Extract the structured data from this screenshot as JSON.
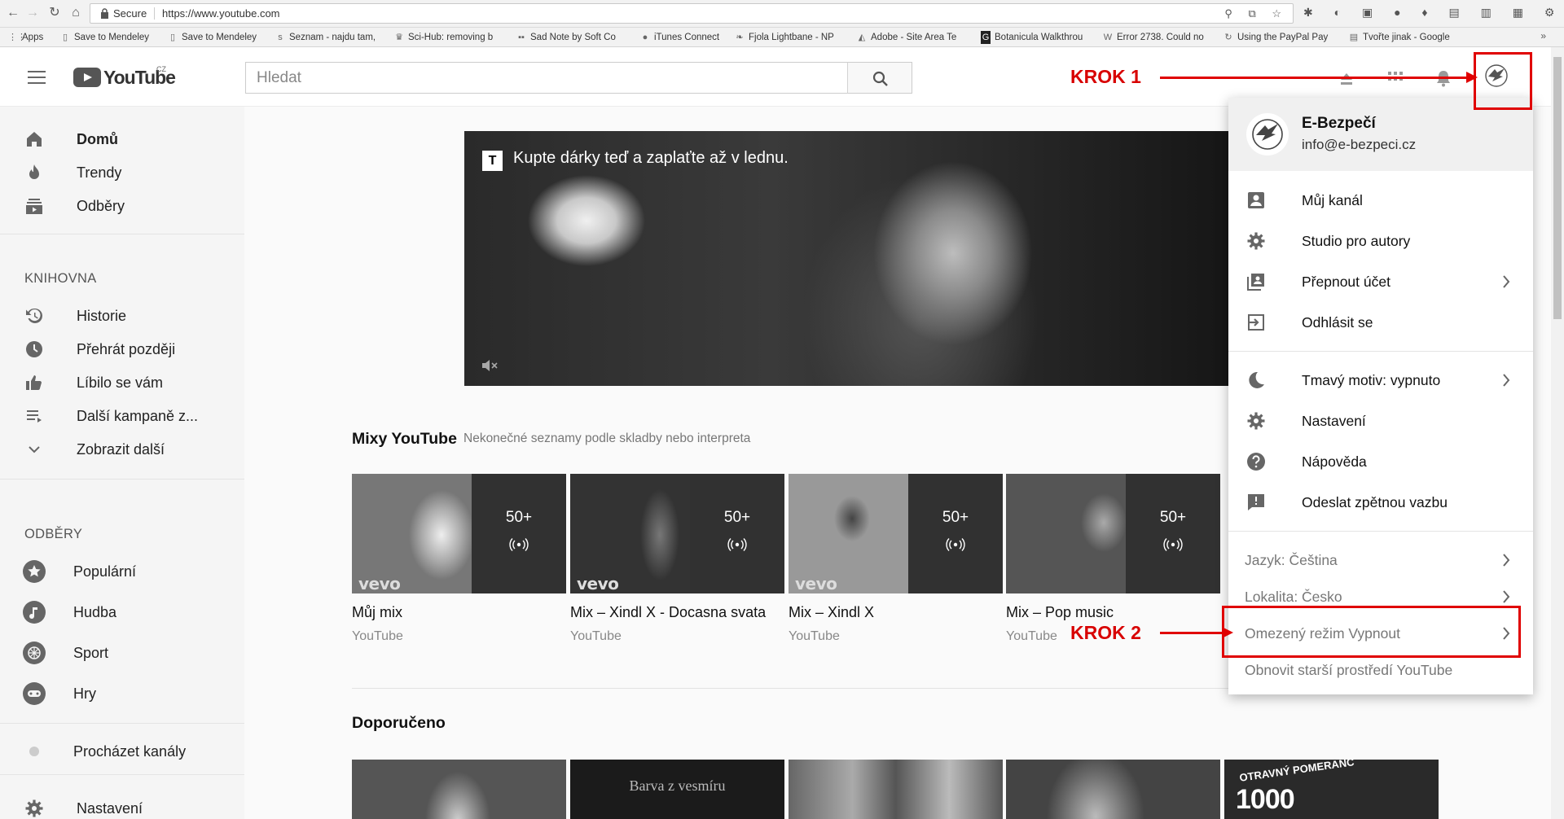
{
  "browser": {
    "secure_label": "Secure",
    "url": "https://www.youtube.com",
    "bookmarks": [
      {
        "icon": "apps-icon",
        "label": "Apps"
      },
      {
        "icon": "page-icon",
        "label": "Save to Mendeley"
      },
      {
        "icon": "page-icon",
        "label": "Save to Mendeley"
      },
      {
        "icon": "seznam-icon",
        "label": "Seznam - najdu tam,"
      },
      {
        "icon": "scihub-icon",
        "label": "Sci-Hub: removing b"
      },
      {
        "icon": "softcorp-icon",
        "label": "Sad Note by Soft Co"
      },
      {
        "icon": "apple-icon",
        "label": "iTunes Connect"
      },
      {
        "icon": "leaf-icon",
        "label": "Fjola Lightbane - NP"
      },
      {
        "icon": "adobe-icon",
        "label": "Adobe - Site Area Te"
      },
      {
        "icon": "g-icon",
        "label": "Botanicula Walkthrou"
      },
      {
        "icon": "wiki-icon",
        "label": "Error 2738. Could no"
      },
      {
        "icon": "refresh-icon",
        "label": "Using the PayPal Pay"
      },
      {
        "icon": "form-icon",
        "label": "Tvořte jinak - Google"
      }
    ],
    "more_bookmarks": "»"
  },
  "masthead": {
    "logo_text": "YouTube",
    "country_code": "CZ",
    "search_placeholder": "Hledat"
  },
  "sidebar": {
    "main": [
      {
        "icon": "home-icon",
        "label": "Domů",
        "active": true
      },
      {
        "icon": "trending-icon",
        "label": "Trendy"
      },
      {
        "icon": "subscriptions-icon",
        "label": "Odběry"
      }
    ],
    "library_heading": "KNIHOVNA",
    "library": [
      {
        "icon": "history-icon",
        "label": "Historie"
      },
      {
        "icon": "clock-icon",
        "label": "Přehrát později"
      },
      {
        "icon": "thumbs-up-icon",
        "label": "Líbilo se vám"
      },
      {
        "icon": "playlist-icon",
        "label": "Další kampaně z..."
      },
      {
        "icon": "chevron-down-icon",
        "label": "Zobrazit další"
      }
    ],
    "subs_heading": "ODBĚRY",
    "subs": [
      {
        "icon": "star-icon",
        "label": "Populární"
      },
      {
        "icon": "music-icon",
        "label": "Hudba"
      },
      {
        "icon": "sport-icon",
        "label": "Sport"
      },
      {
        "icon": "gamepad-icon",
        "label": "Hry"
      }
    ],
    "browse_channels": "Procházet kanály",
    "settings": "Nastavení"
  },
  "banner": {
    "text": "Kupte dárky teď a zaplaťte až v lednu.",
    "badge": "T"
  },
  "mixes": {
    "title": "Mixy YouTube",
    "subtitle": "Nekonečné seznamy podle skladby nebo interpreta",
    "items": [
      {
        "title": "Můj mix",
        "channel": "YouTube",
        "count": "50+",
        "vevo": "vevo"
      },
      {
        "title": "Mix – Xindl X - Docasna svata",
        "channel": "YouTube",
        "count": "50+",
        "vevo": "vevo"
      },
      {
        "title": "Mix – Xindl X",
        "channel": "YouTube",
        "count": "50+",
        "vevo": "vevo"
      },
      {
        "title": "Mix – Pop music",
        "channel": "YouTube",
        "count": "50+",
        "vevo": ""
      }
    ]
  },
  "recommended": {
    "title": "Doporučeno",
    "thumb2_text": "Barva z vesmíru",
    "thumb5_top": "OTRAVNÝ POMERANČ",
    "thumb5_big": "1000"
  },
  "account_menu": {
    "name": "E-Bezpečí",
    "email": "info@e-bezpeci.cz",
    "group1": [
      {
        "icon": "account-box-icon",
        "label": "Můj kanál",
        "chevron": false
      },
      {
        "icon": "gear-icon",
        "label": "Studio pro autory",
        "chevron": false
      },
      {
        "icon": "switch-account-icon",
        "label": "Přepnout účet",
        "chevron": true
      },
      {
        "icon": "sign-out-icon",
        "label": "Odhlásit se",
        "chevron": false
      }
    ],
    "group2": [
      {
        "icon": "moon-icon",
        "label": "Tmavý motiv: vypnuto",
        "chevron": true
      },
      {
        "icon": "gear-icon",
        "label": "Nastavení",
        "chevron": false
      },
      {
        "icon": "help-icon",
        "label": "Nápověda",
        "chevron": false
      },
      {
        "icon": "feedback-icon",
        "label": "Odeslat zpětnou vazbu",
        "chevron": false
      }
    ],
    "group3": [
      {
        "label": "Jazyk: Čeština",
        "chevron": true
      },
      {
        "label": "Lokalita: Česko",
        "chevron": true
      },
      {
        "label": "Omezený režim Vypnout",
        "chevron": true
      },
      {
        "label": "Obnovit starší prostředí YouTube",
        "chevron": false
      }
    ]
  },
  "annotations": {
    "step1": "KROK 1",
    "step2": "KROK 2",
    "color": "#e00000"
  }
}
